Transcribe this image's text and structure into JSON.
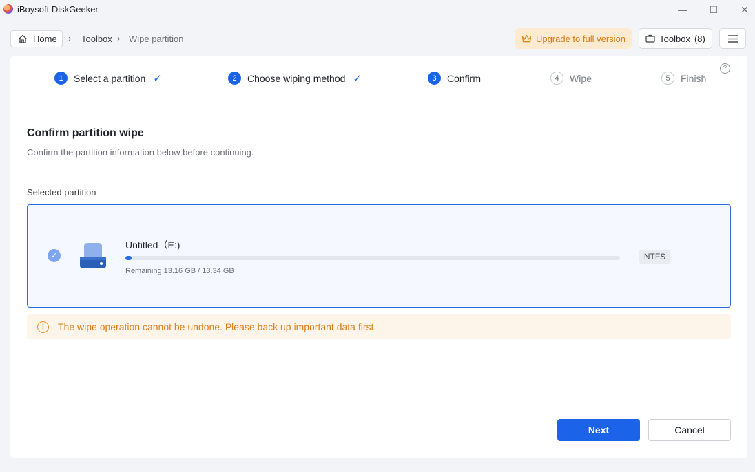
{
  "window": {
    "title": "iBoysoft DiskGeeker",
    "minimize_icon": "—",
    "maximize_icon": "☐",
    "close_icon": "✕"
  },
  "nav": {
    "home_label": "Home",
    "breadcrumb": [
      "Toolbox",
      "Wipe partition"
    ],
    "upgrade_label": "Upgrade to full version",
    "toolbox_label": "Toolbox",
    "toolbox_count": "(8)"
  },
  "steps": [
    {
      "number": "1",
      "label": "Select a partition",
      "state": "done"
    },
    {
      "number": "2",
      "label": "Choose wiping method",
      "state": "done"
    },
    {
      "number": "3",
      "label": "Confirm",
      "state": "active"
    },
    {
      "number": "4",
      "label": "Wipe",
      "state": "todo"
    },
    {
      "number": "5",
      "label": "Finish",
      "state": "todo"
    }
  ],
  "help_icon_glyph": "?",
  "main": {
    "title": "Confirm partition wipe",
    "subtitle": "Confirm the partition information below before continuing.",
    "section_label": "Selected partition"
  },
  "partition": {
    "name": "Untitled（E:)",
    "remaining_text": "Remaining 13.16 GB / 13.34 GB",
    "filesystem": "NTFS",
    "used_fraction": 0.013,
    "selected": true
  },
  "warning": {
    "icon_glyph": "!",
    "text": "The wipe operation cannot be undone. Please back up important data first."
  },
  "actions": {
    "next_label": "Next",
    "cancel_label": "Cancel"
  },
  "colors": {
    "accent": "#1b63e8",
    "warning": "#e07f1c",
    "upgrade_bg": "#fcebd1"
  }
}
